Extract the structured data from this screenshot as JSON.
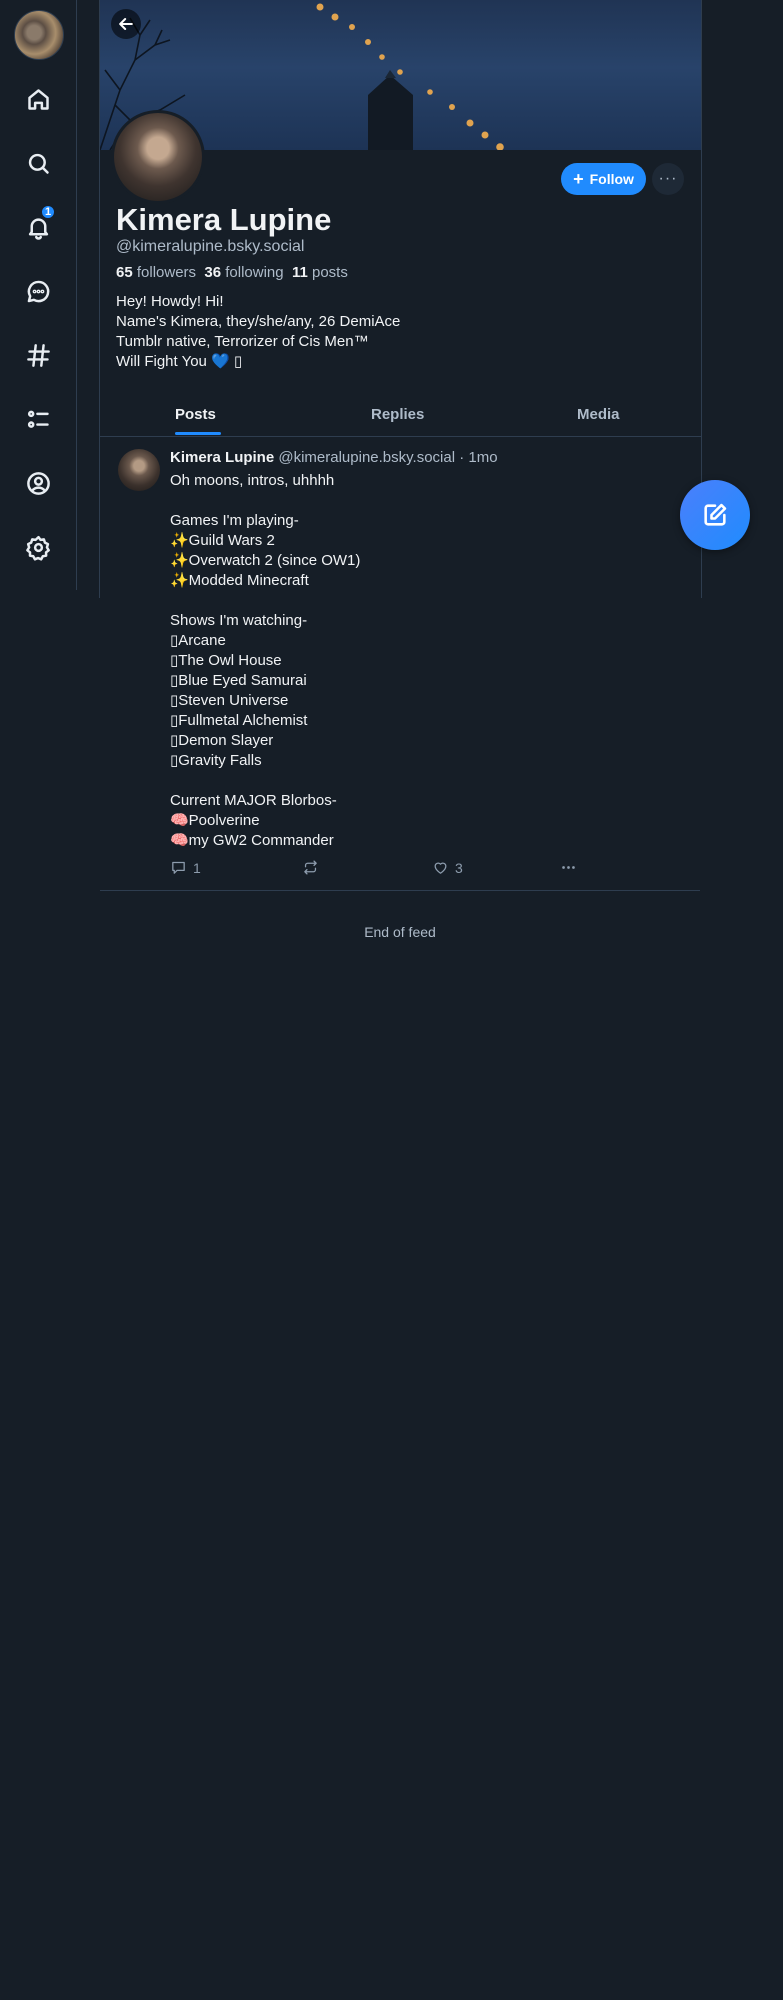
{
  "nav": {
    "notifications_badge": "1",
    "icons": [
      "avatar",
      "home-icon",
      "search-icon",
      "bell-icon",
      "chat-icon",
      "hashtag-icon",
      "list-icon",
      "profile-icon",
      "settings-icon"
    ]
  },
  "profile": {
    "display_name": "Kimera Lupine",
    "handle": "@kimeralupine.bsky.social",
    "followers_count": "65",
    "followers_label": "followers",
    "following_count": "36",
    "following_label": "following",
    "posts_count": "11",
    "posts_label": "posts",
    "bio": [
      "Hey! Howdy! Hi!",
      "Name's Kimera, they/she/any, 26 DemiAce",
      "Tumblr native, Terrorizer of Cis Men™",
      "Will Fight You 💙 ▯"
    ],
    "follow_label": "Follow",
    "more_label": "···"
  },
  "tabs": [
    {
      "label": "Posts",
      "active": true
    },
    {
      "label": "Replies",
      "active": false
    },
    {
      "label": "Media",
      "active": false
    }
  ],
  "post": {
    "author": "Kimera Lupine",
    "handle": "@kimeralupine.bsky.social",
    "time": "· 1mo",
    "text": "Oh moons, intros, uhhhh\n\nGames I'm playing-\n✨Guild Wars 2\n✨Overwatch 2 (since OW1)\n✨Modded Minecraft\n\nShows I'm watching-\n▯Arcane\n▯The Owl House\n▯Blue Eyed Samurai\n▯Steven Universe\n▯Fullmetal Alchemist\n▯Demon Slayer\n▯Gravity Falls\n\nCurrent MAJOR Blorbos-\n🧠Poolverine\n🧠my GW2 Commander",
    "reply_count": "1",
    "like_count": "3"
  },
  "feed": {
    "end_label": "End of feed"
  },
  "colors": {
    "background": "#161e27",
    "accent": "#208bfe",
    "border": "#2e3d4f",
    "secondary_text": "#aebbc9"
  }
}
